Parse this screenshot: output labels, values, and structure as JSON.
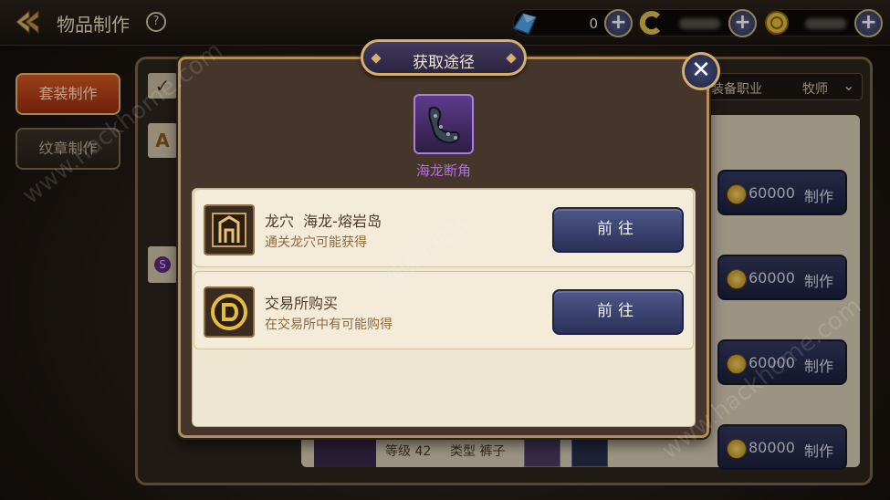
{
  "header": {
    "back_icon": "back-arrow-icon",
    "title": "物品制作",
    "help_icon": "question-mark-icon"
  },
  "resources": [
    {
      "icon": "crystal-icon",
      "value": "0",
      "plus_icon": "plus-icon"
    },
    {
      "icon": "c-coin-icon",
      "value": "",
      "plus_icon": "plus-icon"
    },
    {
      "icon": "gold-coin-icon",
      "value": "",
      "plus_icon": "plus-icon"
    }
  ],
  "sidebar": {
    "tabs": [
      {
        "label": "套装制作",
        "active": true
      },
      {
        "label": "纹章制作",
        "active": false
      }
    ]
  },
  "filter": {
    "label": "装备职业",
    "selected": "牧师"
  },
  "category_icons": [
    "A",
    "S"
  ],
  "craft_rows": [
    {
      "cost": "60000",
      "button": "制作"
    },
    {
      "cost": "60000",
      "button": "制作"
    },
    {
      "cost": "60000",
      "button": "制作"
    },
    {
      "cost": "80000",
      "button": "制作"
    }
  ],
  "bottom_row": {
    "level": "等级 42",
    "type": "类型 裤子"
  },
  "dialog": {
    "title": "获取途径",
    "close_icon": "close-x-icon",
    "item": {
      "name": "海龙断角",
      "icon": "sea-dragon-horn-icon"
    },
    "routes": [
      {
        "icon": "dragon-lair-icon",
        "name": "龙穴  海龙-熔岩岛",
        "desc": "通关龙穴可能获得",
        "button": "前往"
      },
      {
        "icon": "exchange-coin-icon",
        "name": "交易所购买",
        "desc": "在交易所中有可能购得",
        "button": "前往"
      }
    ]
  },
  "watermarks": [
    "www.hackhome.com",
    "www.hackhome.com",
    "网侠手机站"
  ],
  "colors": {
    "accent_gold": "#d4af6d",
    "item_purple": "#b36ee6",
    "button_blue": "#2a3057",
    "active_tab": "#c04a1c"
  }
}
